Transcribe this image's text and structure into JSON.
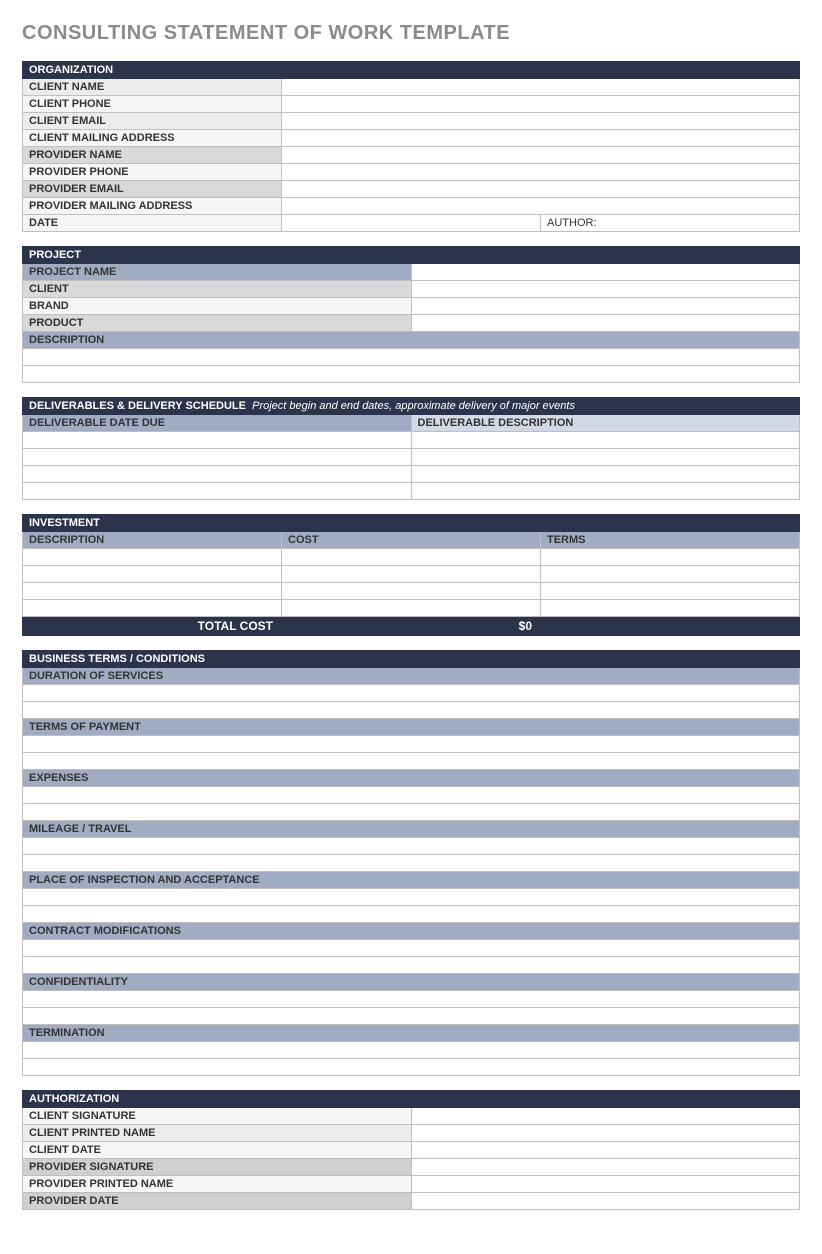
{
  "title": "CONSULTING STATEMENT OF WORK TEMPLATE",
  "organization": {
    "header": "ORGANIZATION",
    "rows": {
      "client_name": "CLIENT NAME",
      "client_phone": "CLIENT  PHONE",
      "client_email": "CLIENT EMAIL",
      "client_mailing": "CLIENT MAILING ADDRESS",
      "provider_name": "PROVIDER NAME",
      "provider_phone": "PROVIDER PHONE",
      "provider_email": "PROVIDER EMAIL",
      "provider_mailing": "PROVIDER MAILING ADDRESS",
      "date": "DATE",
      "author": "AUTHOR:"
    }
  },
  "project": {
    "header": "PROJECT",
    "rows": {
      "project_name": "PROJECT NAME",
      "client": "CLIENT",
      "brand": "BRAND",
      "product": "PRODUCT",
      "description": "DESCRIPTION"
    }
  },
  "deliverables": {
    "header": "DELIVERABLES & DELIVERY SCHEDULE",
    "note": "Project begin and end dates, approximate delivery of major events",
    "col_a": "DELIVERABLE DATE DUE",
    "col_b": "DELIVERABLE DESCRIPTION"
  },
  "investment": {
    "header": "INVESTMENT",
    "col_a": "DESCRIPTION",
    "col_b": "COST",
    "col_c": "TERMS",
    "total_label": "TOTAL COST",
    "total_value": "$0"
  },
  "terms": {
    "header": "BUSINESS TERMS / CONDITIONS",
    "duration": "DURATION OF SERVICES",
    "payment": "TERMS OF PAYMENT",
    "expenses": "EXPENSES",
    "mileage": "MILEAGE / TRAVEL",
    "inspection": "PLACE OF INSPECTION AND ACCEPTANCE",
    "modifications": "CONTRACT MODIFICATIONS",
    "confidentiality": "CONFIDENTIALITY",
    "termination": "TERMINATION"
  },
  "authorization": {
    "header": "AUTHORIZATION",
    "client_sig": "CLIENT SIGNATURE",
    "client_print": "CLIENT PRINTED NAME",
    "client_date": "CLIENT DATE",
    "provider_sig": "PROVIDER SIGNATURE",
    "provider_print": "PROVIDER PRINTED NAME",
    "provider_date": "PROVIDER DATE"
  }
}
